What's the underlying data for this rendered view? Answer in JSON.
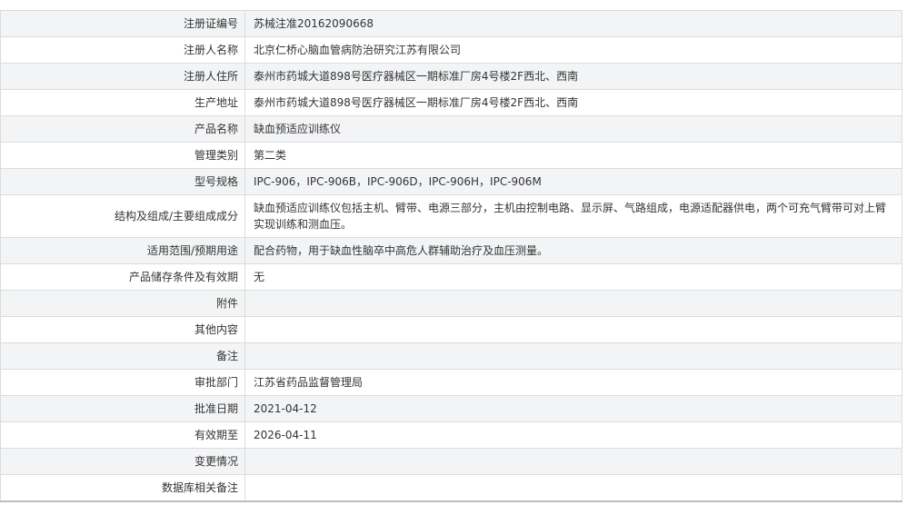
{
  "rows": [
    {
      "label": "注册证编号",
      "value": "苏械注准20162090668"
    },
    {
      "label": "注册人名称",
      "value": "北京仁桥心脑血管病防治研究江苏有限公司"
    },
    {
      "label": "注册人住所",
      "value": "泰州市药城大道898号医疗器械区一期标准厂房4号楼2F西北、西南"
    },
    {
      "label": "生产地址",
      "value": "泰州市药城大道898号医疗器械区一期标准厂房4号楼2F西北、西南"
    },
    {
      "label": "产品名称",
      "value": "缺血预适应训练仪"
    },
    {
      "label": "管理类别",
      "value": "第二类"
    },
    {
      "label": "型号规格",
      "value": "IPC-906，IPC-906B，IPC-906D，IPC-906H，IPC-906M"
    },
    {
      "label": "结构及组成/主要组成成分",
      "value": "缺血预适应训练仪包括主机、臂带、电源三部分，主机由控制电路、显示屏、气路组成，电源适配器供电，两个可充气臂带可对上臂实现训练和测血压。"
    },
    {
      "label": "适用范围/预期用途",
      "value": "配合药物，用于缺血性脑卒中高危人群辅助治疗及血压测量。"
    },
    {
      "label": "产品储存条件及有效期",
      "value": "无"
    },
    {
      "label": "附件",
      "value": ""
    },
    {
      "label": "其他内容",
      "value": ""
    },
    {
      "label": "备注",
      "value": ""
    },
    {
      "label": "审批部门",
      "value": "江苏省药品监督管理局"
    },
    {
      "label": "批准日期",
      "value": "2021-04-12"
    },
    {
      "label": "有效期至",
      "value": "2026-04-11"
    },
    {
      "label": "变更情况",
      "value": ""
    },
    {
      "label": "数据库相关备注",
      "value": ""
    }
  ]
}
